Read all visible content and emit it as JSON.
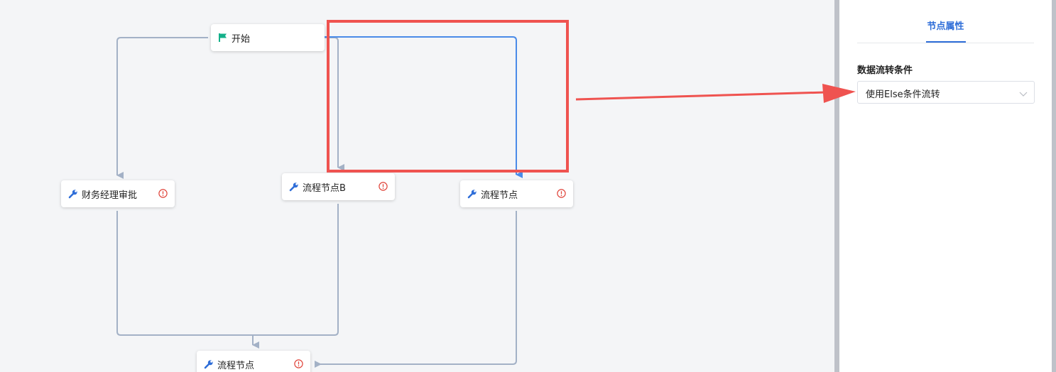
{
  "canvas": {
    "nodes": {
      "start": {
        "label": "开始",
        "icon": "flag-icon"
      },
      "finance": {
        "label": "财务经理审批",
        "icon": "wrench-icon",
        "status": "warning"
      },
      "flowB": {
        "label": "流程节点B",
        "icon": "wrench-icon",
        "status": "warning"
      },
      "flowC": {
        "label": "流程节点",
        "icon": "wrench-icon",
        "status": "warning"
      },
      "merge": {
        "label": "流程节点",
        "icon": "wrench-icon",
        "status": "warning"
      }
    }
  },
  "panel": {
    "tab_label": "节点属性",
    "field_label": "数据流转条件",
    "select_value": "使用Else条件流转"
  },
  "colors": {
    "edge": "#a3b1c6",
    "edge_selected": "#4a8be8",
    "warning": "#e0443a",
    "accent": "#2f6ed8",
    "annotation": "#ef5350",
    "start_flag": "#14b08a"
  }
}
